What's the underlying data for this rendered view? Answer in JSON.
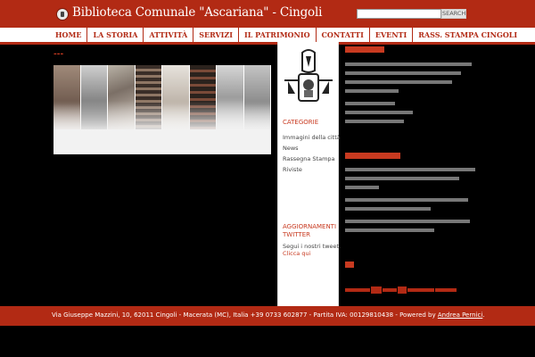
{
  "header": {
    "title": "Biblioteca Comunale \"Ascariana\" - Cingoli",
    "search_button": "SEARCH",
    "search_placeholder": ""
  },
  "nav": {
    "items": [
      {
        "label": "HOME"
      },
      {
        "label": "LA STORIA"
      },
      {
        "label": "ATTIVITÀ"
      },
      {
        "label": "SERVIZI"
      },
      {
        "label": "IL PATRIMONIO"
      },
      {
        "label": "CONTATTI"
      },
      {
        "label": "EVENTI"
      },
      {
        "label": "RASS. STAMPA CINGOLI"
      }
    ]
  },
  "main": {
    "post_title": "---",
    "post_text": "",
    "post_meta": ""
  },
  "sidebar": {
    "categories_heading": "CATEGORIE",
    "categories": [
      {
        "label": "Immagini della città"
      },
      {
        "label": "News"
      },
      {
        "label": "Rassegna Stampa"
      },
      {
        "label": "Riviste"
      }
    ],
    "twitter_heading": "AGGIORNAMENTI TWITTER",
    "twitter_text": "Segui i nostri tweet.",
    "twitter_link": "Clicca qui"
  },
  "footer": {
    "text": "Via Giuseppe Mazzini, 10, 62011 Cingoli - Macerata (MC), Italia +39 0733 602877 - Partita IVA: 00129810438 - Powered by ",
    "link": "Andrea Pernici",
    "end": "."
  },
  "colors": {
    "brand_red": "#b22a14",
    "accent_red": "#c83a20",
    "background": "#000000",
    "nav_background": "#ffffff"
  }
}
